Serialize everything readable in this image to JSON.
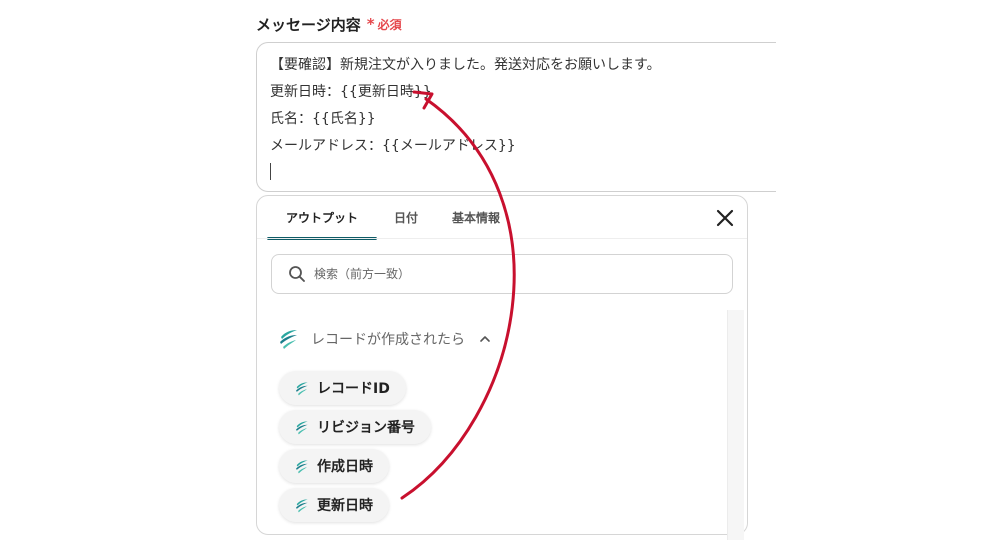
{
  "field": {
    "label": "メッセージ内容",
    "required_mark": "*",
    "required_text": "必須"
  },
  "message": {
    "lines": [
      "【要確認】新規注文が入りました。発送対応をお願いします。",
      "更新日時：{{更新日時}}",
      "氏名：{{氏名}}",
      "メールアドレス：{{メールアドレス}}"
    ]
  },
  "panel": {
    "tabs": [
      "アウトプット",
      "日付",
      "基本情報"
    ],
    "active_tab": "アウトプット",
    "search": {
      "placeholder": "検索（前方一致）"
    },
    "group": {
      "title": "レコードが作成されたら",
      "expanded": true,
      "items": [
        "レコードID",
        "リビジョン番号",
        "作成日時",
        "更新日時"
      ]
    }
  },
  "colors": {
    "accent_tab": "#0e5b66",
    "required": "#e5484d",
    "arrow": "#c8102e",
    "app_icon": "#2aa7a0"
  },
  "icons": {
    "close": "close-icon",
    "search": "search-icon",
    "chevron": "chevron-up-icon",
    "app": "kintone-icon"
  }
}
